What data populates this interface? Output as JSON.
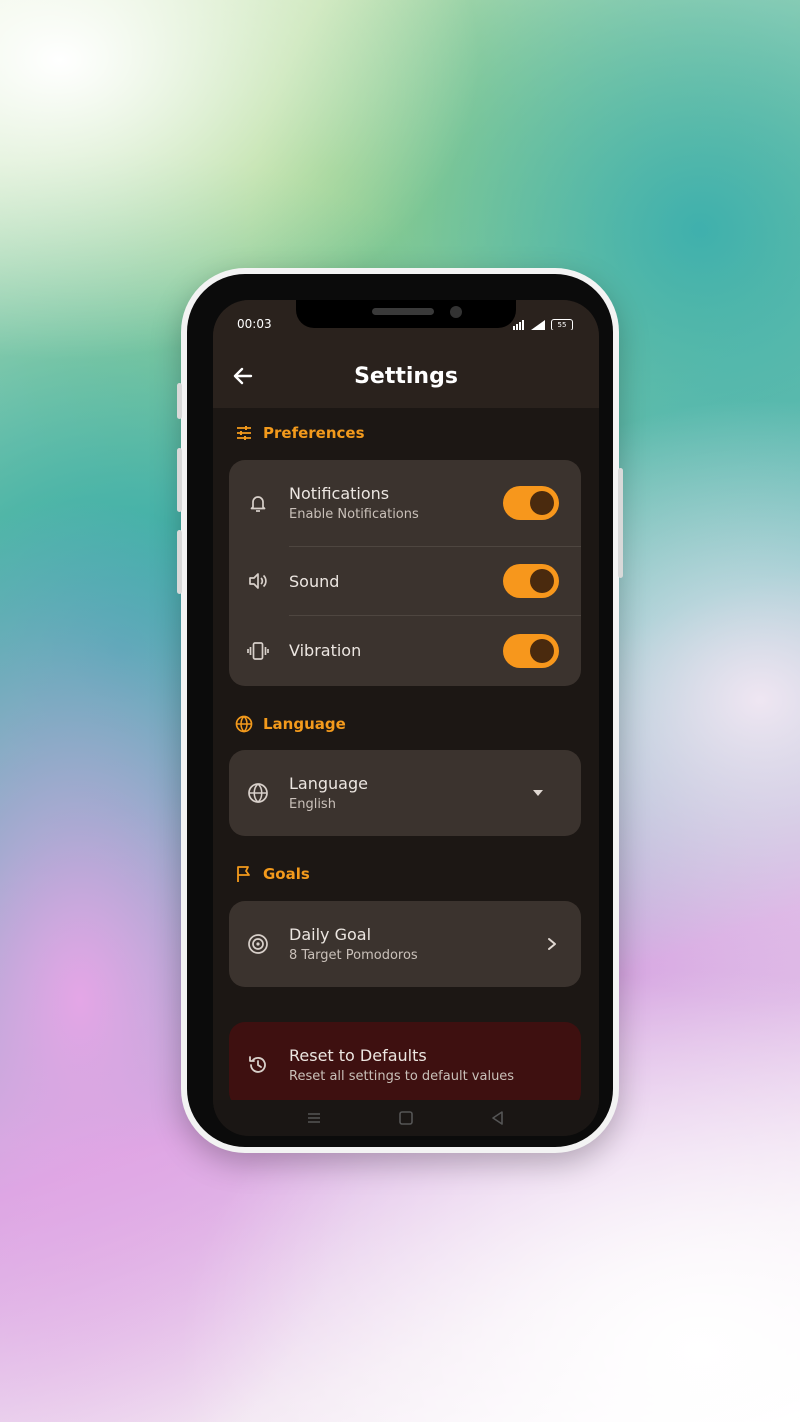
{
  "status": {
    "time": "00:03",
    "battery": "55"
  },
  "appbar": {
    "title": "Settings"
  },
  "sections": {
    "preferences": {
      "title": "Preferences"
    },
    "language": {
      "title": "Language"
    },
    "goals": {
      "title": "Goals"
    }
  },
  "preferences": {
    "notifications": {
      "label": "Notifications",
      "subtitle": "Enable Notifications",
      "enabled": true
    },
    "sound": {
      "label": "Sound",
      "enabled": true
    },
    "vibration": {
      "label": "Vibration",
      "enabled": true
    }
  },
  "language": {
    "label": "Language",
    "value": "English"
  },
  "goals": {
    "daily_goal": {
      "label": "Daily Goal",
      "subtitle": "8 Target Pomodoros"
    }
  },
  "reset": {
    "label": "Reset to Defaults",
    "subtitle": "Reset all settings to default values"
  },
  "colors": {
    "accent": "#f7971c",
    "card": "#3b332e",
    "background": "#1c1714",
    "reset_card": "#3e1010"
  },
  "icons": {
    "back": "arrow-left-icon",
    "preferences": "sliders-icon",
    "notifications": "bell-icon",
    "sound": "speaker-icon",
    "vibration": "vibration-icon",
    "language": "globe-icon",
    "dropdown": "caret-down-icon",
    "goals": "flag-icon",
    "daily_goal": "target-icon",
    "chevron": "chevron-right-icon",
    "reset": "history-icon"
  }
}
